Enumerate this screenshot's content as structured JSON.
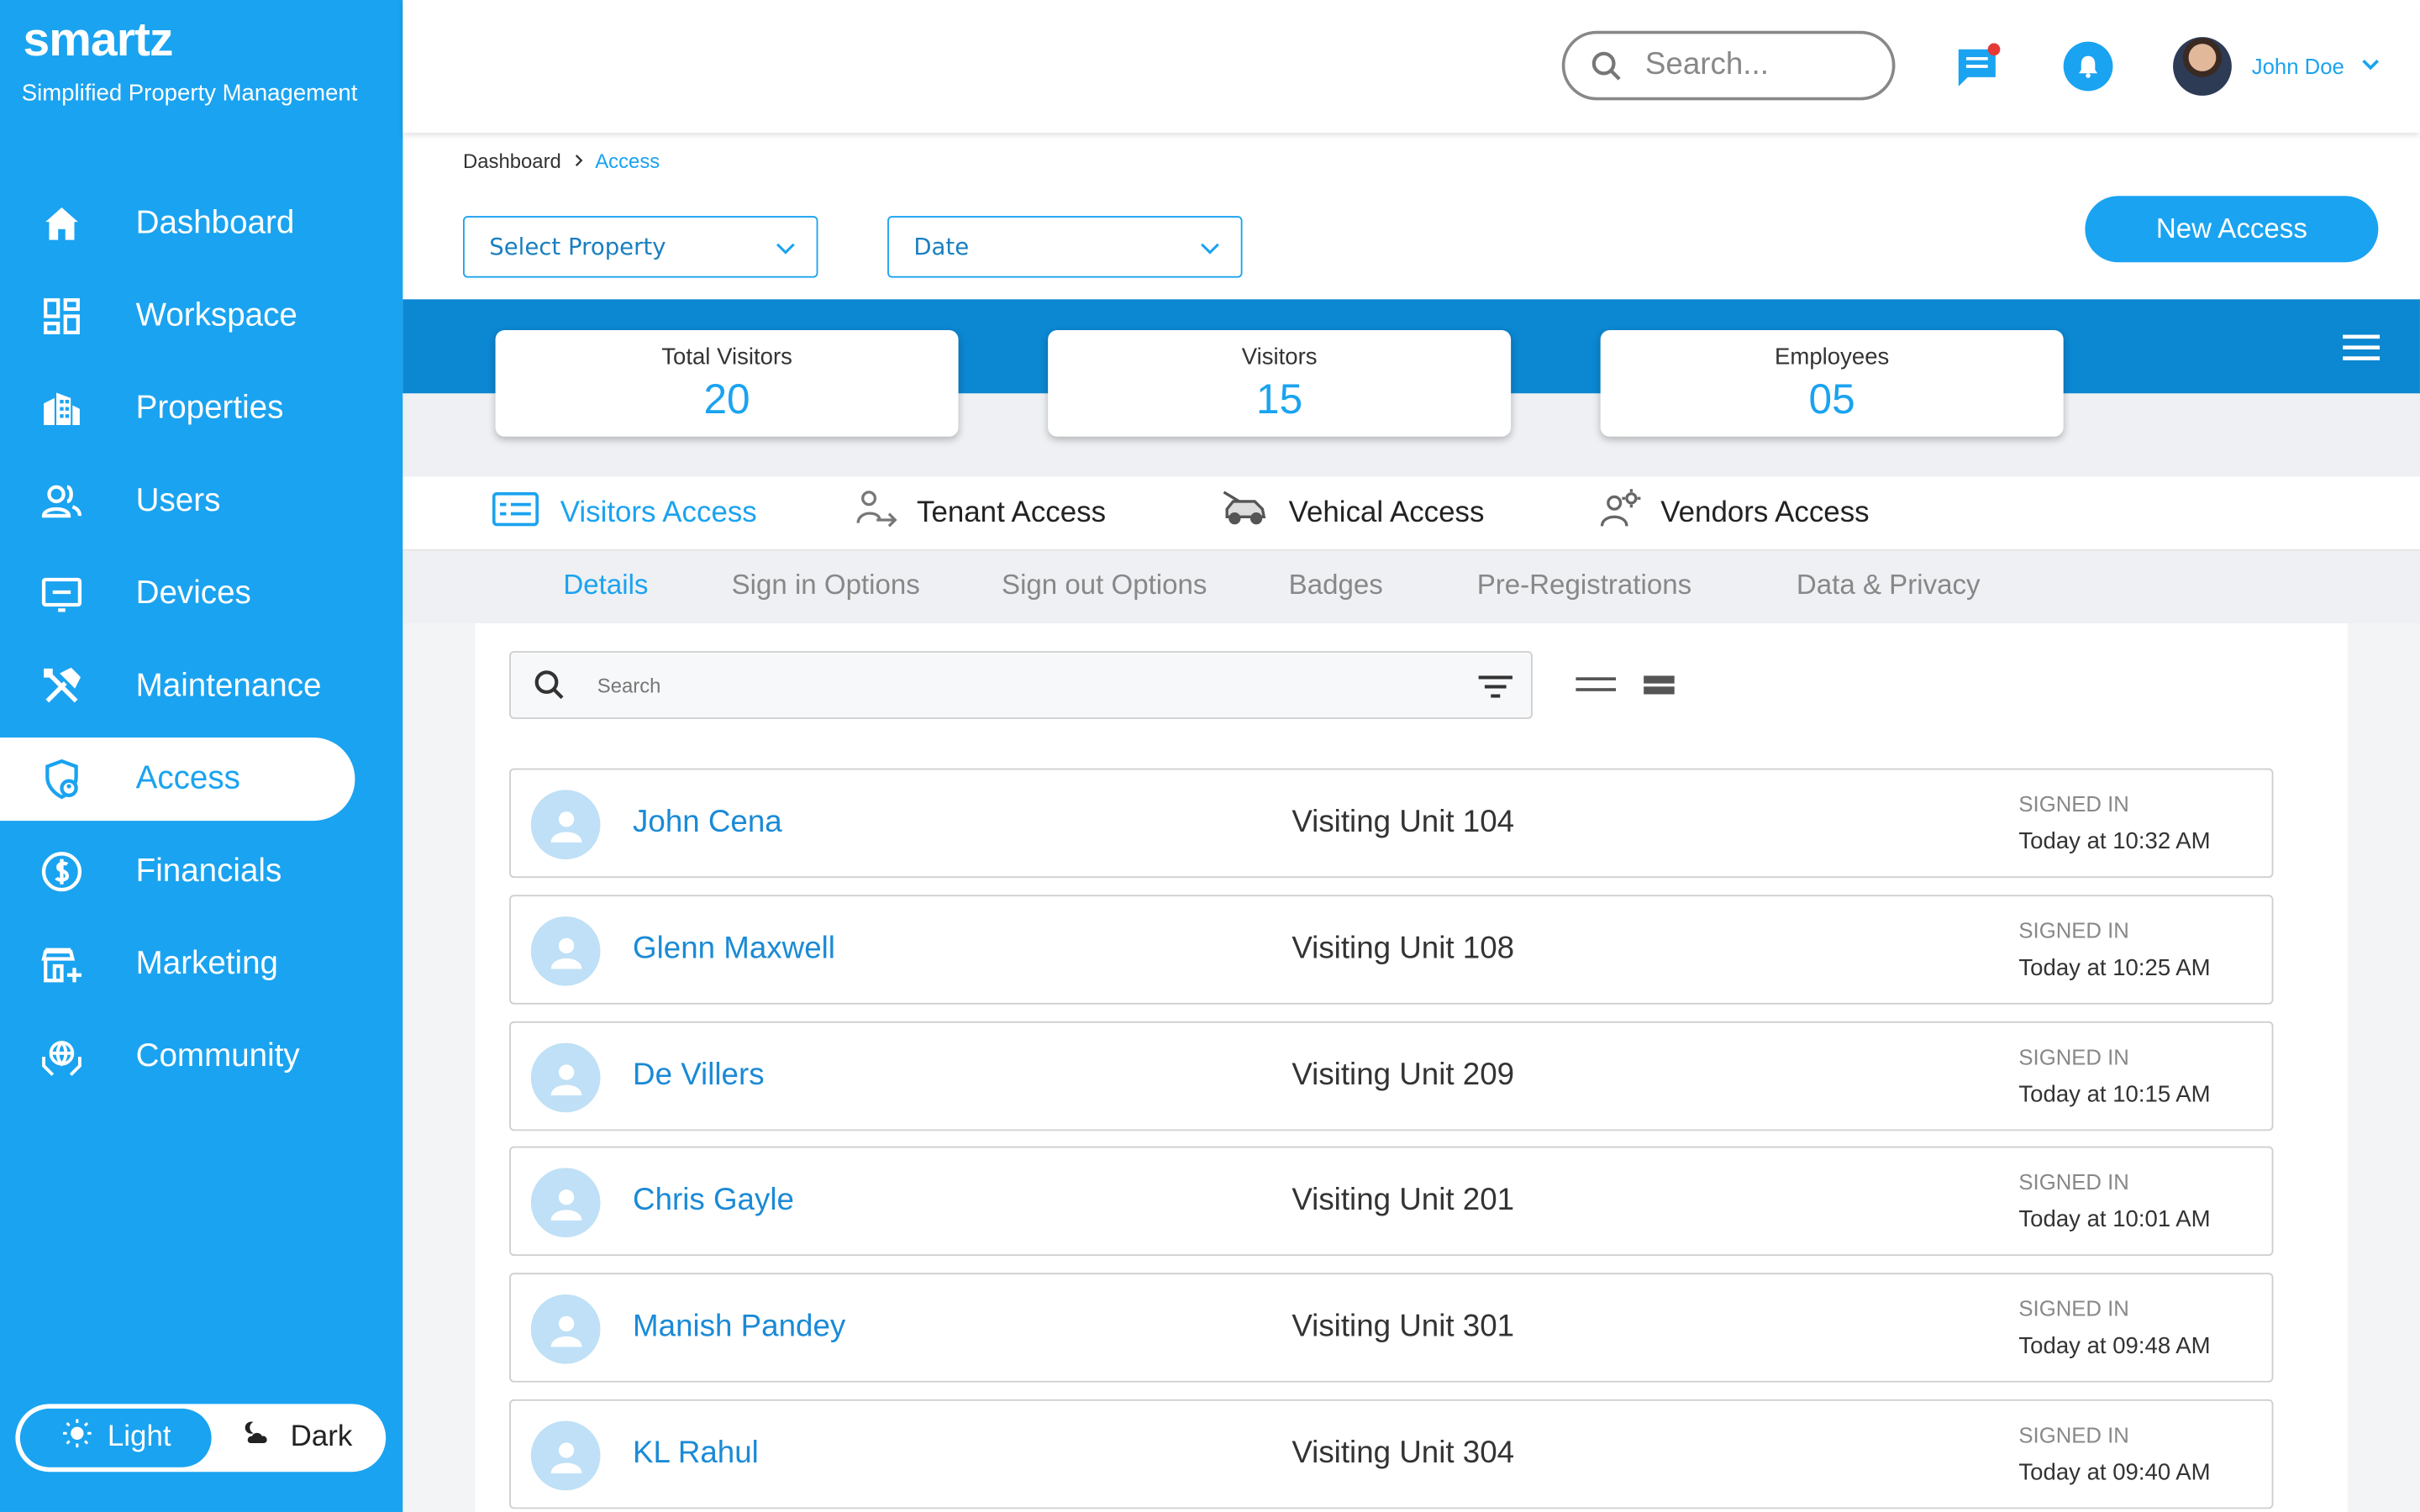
{
  "brand": {
    "logo": "smartz",
    "tagline": "Simplified Property Management"
  },
  "sidebar": {
    "items": [
      {
        "label": "Dashboard",
        "icon": "home-icon"
      },
      {
        "label": "Workspace",
        "icon": "grid-icon"
      },
      {
        "label": "Properties",
        "icon": "building-icon"
      },
      {
        "label": "Users",
        "icon": "users-icon"
      },
      {
        "label": "Devices",
        "icon": "monitor-icon"
      },
      {
        "label": "Maintenance",
        "icon": "tools-icon"
      },
      {
        "label": "Access",
        "icon": "shield-icon",
        "active": true
      },
      {
        "label": "Financials",
        "icon": "dollar-icon"
      },
      {
        "label": "Marketing",
        "icon": "store-icon"
      },
      {
        "label": "Community",
        "icon": "globe-hands-icon"
      }
    ],
    "theme": {
      "light": "Light",
      "dark": "Dark",
      "selected": "Light"
    }
  },
  "topbar": {
    "search_placeholder": "Search...",
    "user_name": "John Doe"
  },
  "breadcrumb": {
    "root": "Dashboard",
    "current": "Access"
  },
  "filters": {
    "property": "Select Property",
    "date": "Date"
  },
  "new_access_label": "New Access",
  "stats": [
    {
      "label": "Total Visitors",
      "value": "20"
    },
    {
      "label": "Visitors",
      "value": "15"
    },
    {
      "label": "Employees",
      "value": "05"
    }
  ],
  "access_tabs": [
    {
      "label": "Visitors Access",
      "active": true
    },
    {
      "label": "Tenant Access"
    },
    {
      "label": "Vehical Access"
    },
    {
      "label": "Vendors Access"
    }
  ],
  "sub_tabs": [
    {
      "label": "Details",
      "active": true
    },
    {
      "label": "Sign in Options"
    },
    {
      "label": "Sign out Options"
    },
    {
      "label": "Badges"
    },
    {
      "label": "Pre-Registrations"
    },
    {
      "label": "Data & Privacy"
    }
  ],
  "list_search_placeholder": "Search",
  "visitors": [
    {
      "name": "John Cena",
      "unit": "Visiting Unit 104",
      "status": "SIGNED IN",
      "time": "Today at 10:32 AM"
    },
    {
      "name": "Glenn Maxwell",
      "unit": "Visiting Unit 108",
      "status": "SIGNED IN",
      "time": "Today at 10:25 AM"
    },
    {
      "name": "De Villers",
      "unit": "Visiting Unit 209",
      "status": "SIGNED IN",
      "time": "Today at 10:15 AM"
    },
    {
      "name": "Chris Gayle",
      "unit": "Visiting Unit 201",
      "status": "SIGNED IN",
      "time": "Today at 10:01 AM"
    },
    {
      "name": "Manish Pandey",
      "unit": "Visiting Unit 301",
      "status": "SIGNED IN",
      "time": "Today at 09:48 AM"
    },
    {
      "name": "KL Rahul",
      "unit": "Visiting Unit 304",
      "status": "SIGNED IN",
      "time": "Today at 09:40 AM"
    }
  ],
  "colors": {
    "accent": "#1aa3f0",
    "band": "#0c87d1",
    "notification_dot": "#e53935"
  }
}
